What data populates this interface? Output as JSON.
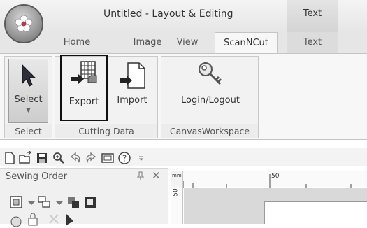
{
  "window": {
    "title": "Untitled - Layout & Editing",
    "context_tab_header": "Text"
  },
  "tabs": [
    {
      "label": "Home"
    },
    {
      "label": "Image"
    },
    {
      "label": "View"
    },
    {
      "label": "ScanNCut",
      "active": true
    },
    {
      "label": "Text"
    }
  ],
  "ribbon": {
    "groups": [
      {
        "label": "Select",
        "buttons": [
          {
            "label": "Select",
            "icon": "arrow-cursor-icon"
          }
        ]
      },
      {
        "label": "Cutting Data",
        "buttons": [
          {
            "label": "Export",
            "icon": "export-grid-icon",
            "highlighted": true
          },
          {
            "label": "Import",
            "icon": "import-page-icon"
          }
        ]
      },
      {
        "label": "CanvasWorkspace",
        "buttons": [
          {
            "label": "Login/Logout",
            "icon": "key-icon"
          }
        ]
      }
    ]
  },
  "quick_access": [
    "new-file-icon",
    "open-folder-icon",
    "save-icon",
    "zoom-icon",
    "undo-icon",
    "redo-icon",
    "preview-icon",
    "help-icon",
    "customize-dropdown-icon"
  ],
  "panel": {
    "title": "Sewing Order",
    "pin": "ᵖ",
    "close": "✕"
  },
  "ruler": {
    "unit": "mm",
    "h_label": "50",
    "v_label": "50"
  },
  "colors": {
    "accent_tab_bg": "#f7f7f7",
    "ribbon_bg": "#f7f7f7",
    "highlight_border": "#111111"
  }
}
